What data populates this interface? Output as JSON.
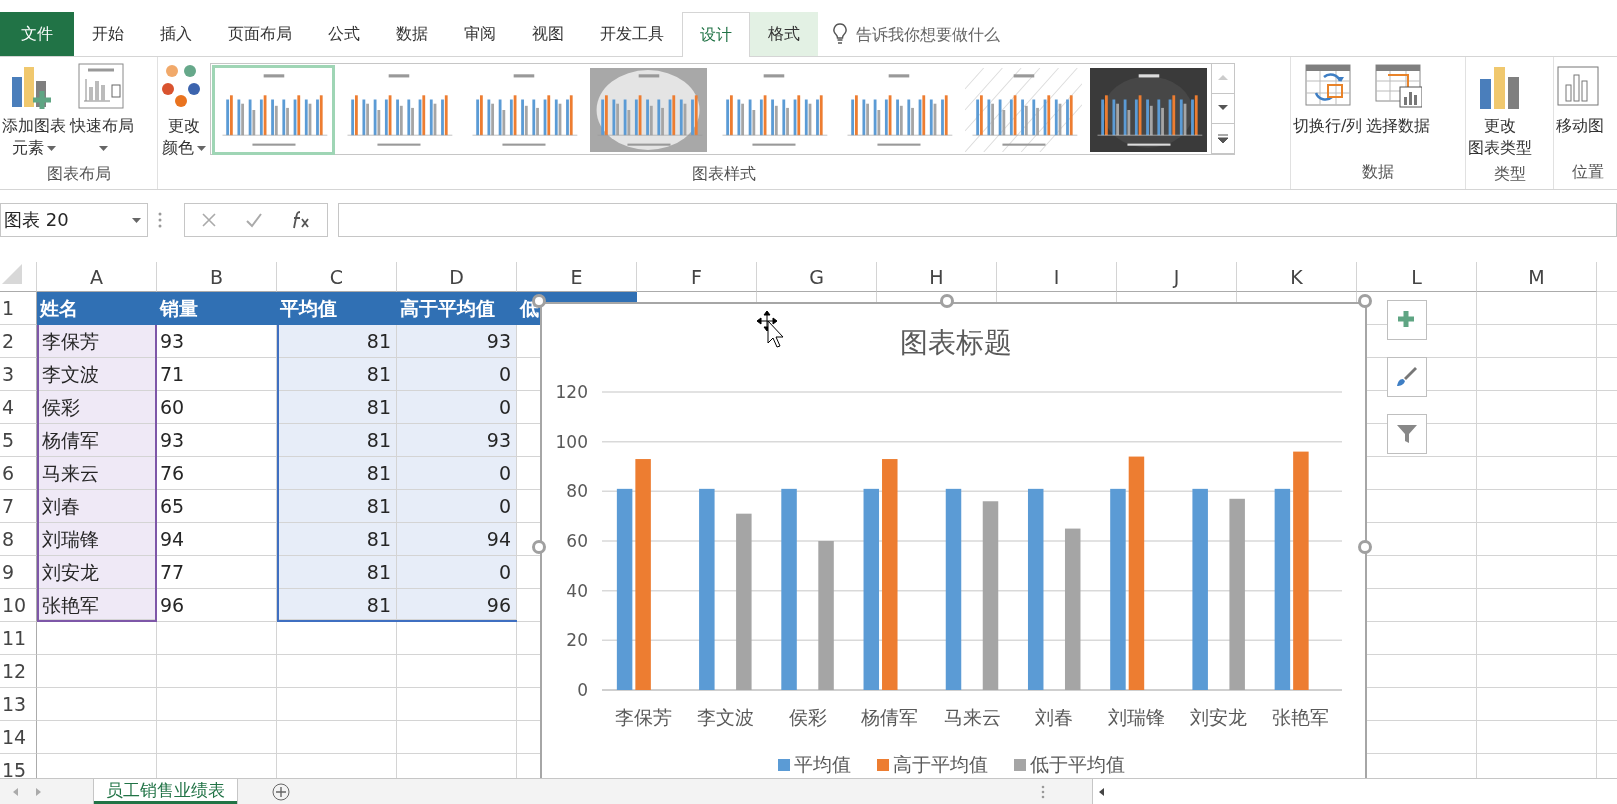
{
  "ribbon_tabs": [
    {
      "label": "文件",
      "kind": "file",
      "selected": false
    },
    {
      "label": "开始",
      "kind": "normal",
      "selected": false
    },
    {
      "label": "插入",
      "kind": "normal",
      "selected": false
    },
    {
      "label": "页面布局",
      "kind": "normal",
      "selected": false
    },
    {
      "label": "公式",
      "kind": "normal",
      "selected": false
    },
    {
      "label": "数据",
      "kind": "normal",
      "selected": false
    },
    {
      "label": "审阅",
      "kind": "normal",
      "selected": false
    },
    {
      "label": "视图",
      "kind": "normal",
      "selected": false
    },
    {
      "label": "开发工具",
      "kind": "normal",
      "selected": false
    },
    {
      "label": "设计",
      "kind": "contextual",
      "selected": true
    },
    {
      "label": "格式",
      "kind": "contextual",
      "selected": false
    }
  ],
  "tell_me": {
    "placeholder": "告诉我你想要做什么"
  },
  "ribbon_groups": [
    {
      "label": "图表布局",
      "buttons": [
        {
          "kind": "add-element",
          "lines": [
            "添加图表",
            "元素"
          ],
          "dropdown": true
        },
        {
          "kind": "quick-layout",
          "lines": [
            "快速布局"
          ],
          "dropdown": true
        }
      ]
    },
    {
      "label": "图表样式",
      "buttons": [
        {
          "kind": "change-colors",
          "lines": [
            "更改",
            "颜色"
          ],
          "dropdown": true
        }
      ],
      "gallery": [
        {
          "kind": "light",
          "selected": true
        },
        {
          "kind": "light",
          "selected": false
        },
        {
          "kind": "light",
          "selected": false
        },
        {
          "kind": "gray",
          "selected": false
        },
        {
          "kind": "light",
          "selected": false
        },
        {
          "kind": "light",
          "selected": false
        },
        {
          "kind": "hatched",
          "selected": false
        },
        {
          "kind": "dark",
          "selected": false
        }
      ]
    },
    {
      "label": "数据",
      "buttons": [
        {
          "kind": "switch-row-col",
          "lines": [
            "切换行/列"
          ],
          "dropdown": false
        },
        {
          "kind": "select-data",
          "lines": [
            "选择数据"
          ],
          "dropdown": false
        }
      ]
    },
    {
      "label": "类型",
      "buttons": [
        {
          "kind": "change-type",
          "lines": [
            "更改",
            "图表类型"
          ],
          "dropdown": false
        }
      ]
    },
    {
      "label": "位置",
      "buttons": [
        {
          "kind": "move-chart",
          "lines": [
            "移动图"
          ],
          "dropdown": false
        }
      ]
    }
  ],
  "name_box": "图表 20",
  "sheet": {
    "columns": [
      "A",
      "B",
      "C",
      "D",
      "E",
      "F",
      "G",
      "H",
      "I",
      "J",
      "K",
      "L",
      "M"
    ],
    "row_numbers": [
      "1",
      "2",
      "3",
      "4",
      "5",
      "6",
      "7",
      "8",
      "9",
      "10",
      "11",
      "12",
      "13",
      "14",
      "15"
    ],
    "header": [
      "姓名",
      "销量",
      "平均值",
      "高于平均值",
      "低"
    ],
    "rows": [
      [
        "李保芳",
        "93",
        "81",
        "93"
      ],
      [
        "李文波",
        "71",
        "81",
        "0"
      ],
      [
        "侯彩",
        "60",
        "81",
        "0"
      ],
      [
        "杨倩军",
        "93",
        "81",
        "93"
      ],
      [
        "马来云",
        "76",
        "81",
        "0"
      ],
      [
        "刘春",
        "65",
        "81",
        "0"
      ],
      [
        "刘瑞锋",
        "94",
        "81",
        "94"
      ],
      [
        "刘安龙",
        "77",
        "81",
        "0"
      ],
      [
        "张艳军",
        "96",
        "81",
        "96"
      ]
    ]
  },
  "chart": {
    "title": "图表标题",
    "chart_data": {
      "type": "bar",
      "categories": [
        "李保芳",
        "李文波",
        "侯彩",
        "杨倩军",
        "马来云",
        "刘春",
        "刘瑞锋",
        "刘安龙",
        "张艳军"
      ],
      "series": [
        {
          "name": "平均值",
          "color": "#5b9bd5",
          "values": [
            81,
            81,
            81,
            81,
            81,
            81,
            81,
            81,
            81
          ]
        },
        {
          "name": "高于平均值",
          "color": "#ed7d31",
          "values": [
            93,
            0,
            0,
            93,
            0,
            0,
            94,
            0,
            96
          ]
        },
        {
          "name": "低于平均值",
          "color": "#a5a5a5",
          "values": [
            0,
            71,
            60,
            0,
            76,
            65,
            0,
            77,
            0
          ]
        }
      ],
      "ylim": [
        0,
        120
      ],
      "yticks": [
        0,
        20,
        40,
        60,
        80,
        100,
        120
      ],
      "grid": true,
      "legend": true
    }
  },
  "sheet_tabs": [
    {
      "label": "员工销售业绩表",
      "selected": true
    }
  ]
}
